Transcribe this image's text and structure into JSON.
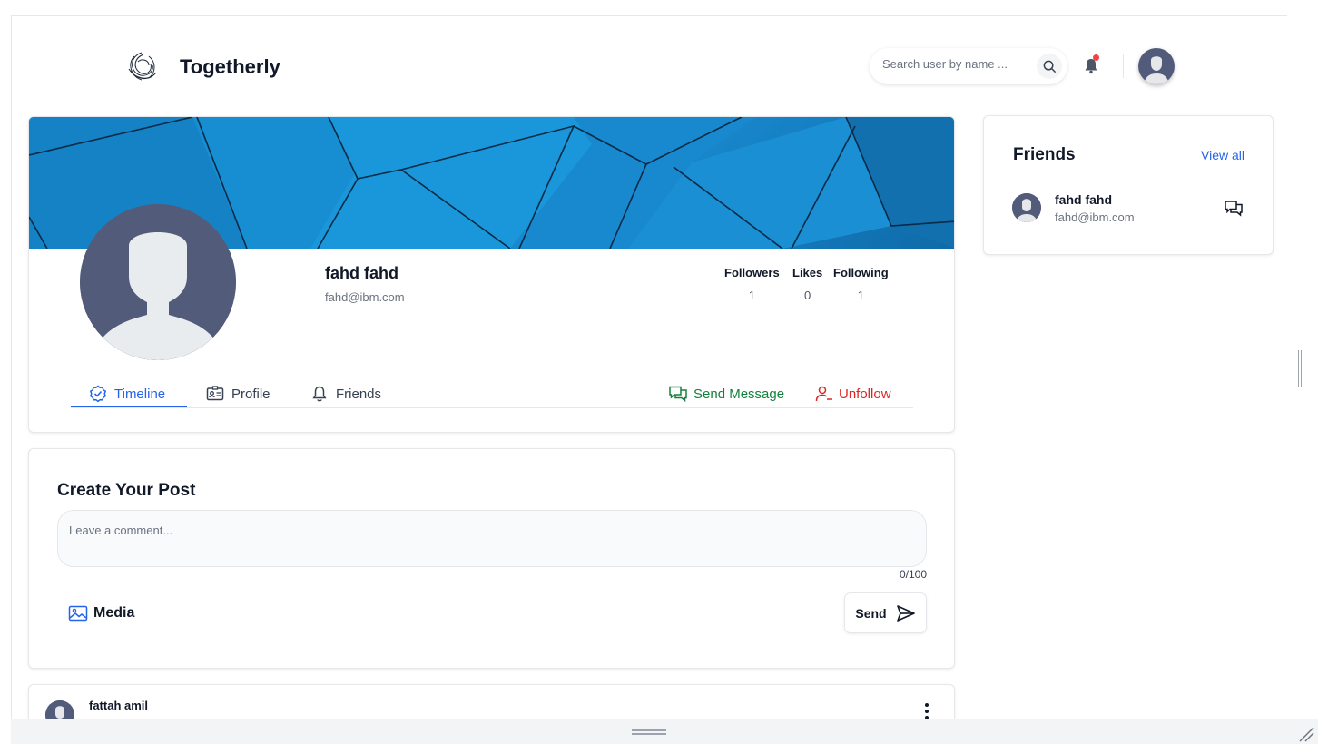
{
  "header": {
    "brand": "Togetherly",
    "search_placeholder": "Search user by name ...",
    "notification_dot_color": "#ef4444"
  },
  "profile": {
    "name": "fahd fahd",
    "email": "fahd@ibm.com",
    "stats": [
      {
        "label": "Followers",
        "value": "1"
      },
      {
        "label": "Likes",
        "value": "0"
      },
      {
        "label": "Following",
        "value": "1"
      }
    ],
    "tabs": [
      {
        "label": "Timeline",
        "icon": "check-badge-icon",
        "active": true
      },
      {
        "label": "Profile",
        "icon": "id-card-icon",
        "active": false
      },
      {
        "label": "Friends",
        "icon": "bell-icon",
        "active": false
      }
    ],
    "actions": {
      "send_message": "Send Message",
      "unfollow": "Unfollow"
    },
    "colors": {
      "accent": "#2563eb",
      "message": "#15803d",
      "unfollow": "#dc2626"
    }
  },
  "create_post": {
    "title": "Create Your Post",
    "placeholder": "Leave a comment...",
    "counter": "0/100",
    "media_label": "Media",
    "send_label": "Send"
  },
  "feed": {
    "first_post_author": "fattah amil"
  },
  "friends": {
    "title": "Friends",
    "view_all": "View all",
    "items": [
      {
        "name": "fahd fahd",
        "email": "fahd@ibm.com"
      }
    ]
  }
}
